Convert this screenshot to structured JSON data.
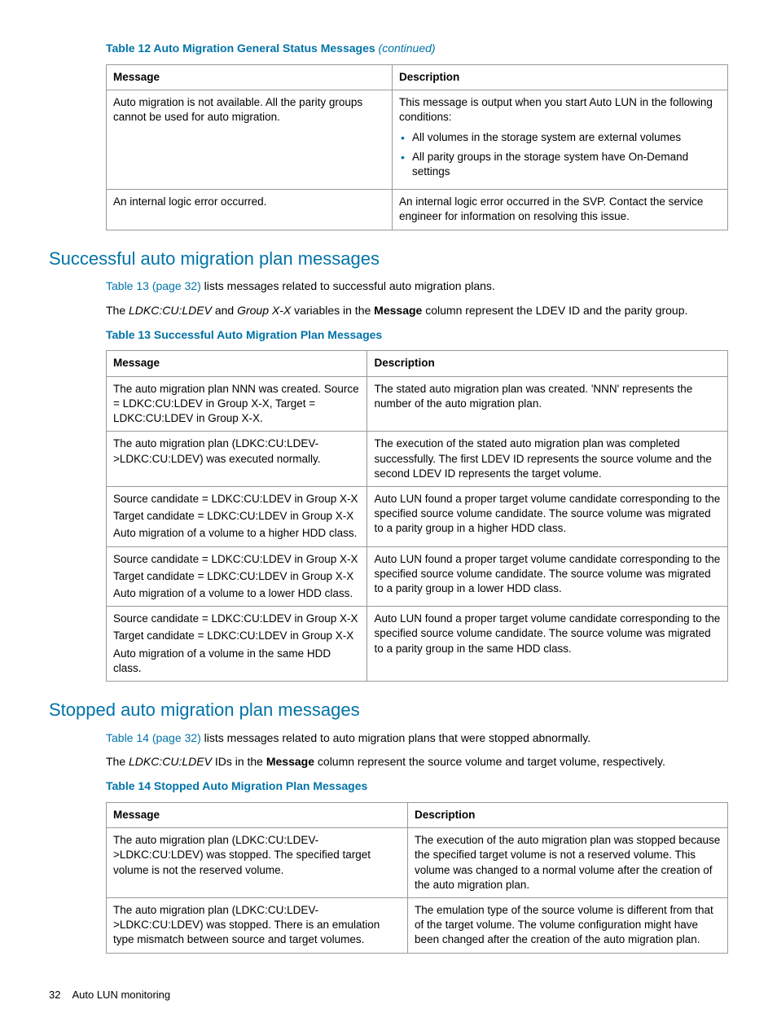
{
  "table12": {
    "title": "Table 12 Auto Migration General Status Messages ",
    "continued": "(continued)",
    "headers": [
      "Message",
      "Description"
    ],
    "rows": [
      {
        "msg": "Auto migration is not available. All the parity groups cannot be used for auto migration.",
        "desc_intro": "This message is output when you start Auto LUN in the following conditions:",
        "desc_bullets": [
          "All volumes in the storage system are external volumes",
          "All parity groups in the storage system have On-Demand settings"
        ]
      },
      {
        "msg": "An internal logic error occurred.",
        "desc": "An internal logic error occurred in the SVP. Contact the service engineer for information on resolving this issue."
      }
    ]
  },
  "section1": {
    "heading": "Successful auto migration plan messages",
    "p1_link": "Table 13 (page 32)",
    "p1_rest": " lists messages related to successful auto migration plans.",
    "p2_a": "The ",
    "p2_i1": "LDKC:CU:LDEV",
    "p2_b": " and ",
    "p2_i2": "Group X-X",
    "p2_c": " variables in the ",
    "p2_bold": "Message",
    "p2_d": " column represent the LDEV ID and the parity group."
  },
  "table13": {
    "title": "Table 13 Successful Auto Migration Plan Messages",
    "headers": [
      "Message",
      "Description"
    ],
    "rows": [
      {
        "msg": "The auto migration plan NNN was created. Source = LDKC:CU:LDEV in Group X-X, Target = LDKC:CU:LDEV in Group X-X.",
        "desc": "The stated auto migration plan was created. 'NNN' represents the number of the auto migration plan."
      },
      {
        "msg": "The auto migration plan (LDKC:CU:LDEV->LDKC:CU:LDEV) was executed normally.",
        "desc": "The execution of the stated auto migration plan was completed successfully. The first LDEV ID represents the source volume and the second LDEV ID represents the target volume."
      },
      {
        "msg_lines": [
          "Source candidate = LDKC:CU:LDEV in Group X-X",
          "Target candidate = LDKC:CU:LDEV in Group X-X",
          "Auto migration of a volume to a higher HDD class."
        ],
        "desc": "Auto LUN found a proper target volume candidate corresponding to the specified source volume candidate. The source volume was migrated to a parity group in a higher HDD class."
      },
      {
        "msg_lines": [
          "Source candidate = LDKC:CU:LDEV in Group X-X",
          "Target candidate = LDKC:CU:LDEV in Group X-X",
          "Auto migration of a volume to a lower HDD class."
        ],
        "desc": "Auto LUN found a proper target volume candidate corresponding to the specified source volume candidate. The source volume was migrated to a parity group in a lower HDD class."
      },
      {
        "msg_lines": [
          "Source candidate = LDKC:CU:LDEV in Group X-X",
          "Target candidate = LDKC:CU:LDEV in Group X-X",
          "Auto migration of a volume in the same HDD class."
        ],
        "desc": "Auto LUN found a proper target volume candidate corresponding to the specified source volume candidate. The source volume was migrated to a parity group in the same HDD class."
      }
    ]
  },
  "section2": {
    "heading": "Stopped auto migration plan messages",
    "p1_link": "Table 14 (page 32)",
    "p1_rest": " lists messages related to auto migration plans that were stopped abnormally.",
    "p2_a": "The ",
    "p2_i1": "LDKC:CU:LDEV",
    "p2_b": " IDs in the ",
    "p2_bold": "Message",
    "p2_c": " column represent the source volume and target volume, respectively."
  },
  "table14": {
    "title": "Table 14 Stopped Auto Migration Plan Messages",
    "headers": [
      "Message",
      "Description"
    ],
    "rows": [
      {
        "msg": "The auto migration plan (LDKC:CU:LDEV->LDKC:CU:LDEV) was stopped. The specified target volume is not the reserved volume.",
        "desc": "The execution of the auto migration plan was stopped because the specified target volume is not a reserved volume. This volume was changed to a normal volume after the creation of the auto migration plan."
      },
      {
        "msg": "The auto migration plan (LDKC:CU:LDEV->LDKC:CU:LDEV) was stopped. There is an emulation type mismatch between source and target volumes.",
        "desc": "The emulation type of the source volume is different from that of the target volume. The volume configuration might have been changed after the creation of the auto migration plan."
      }
    ]
  },
  "footer": {
    "page": "32",
    "section": "Auto LUN monitoring"
  }
}
